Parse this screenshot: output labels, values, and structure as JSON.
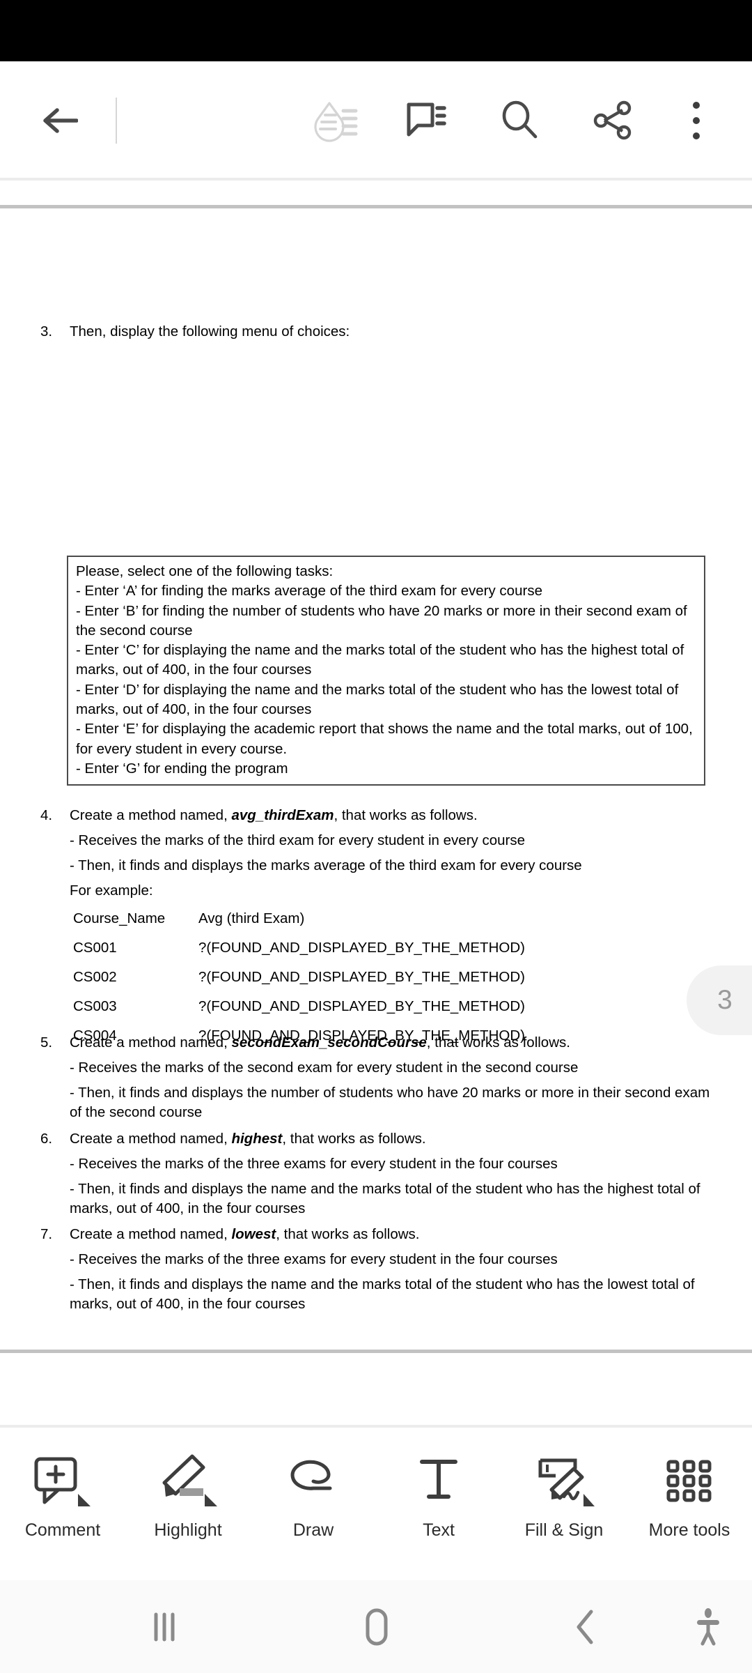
{
  "app": {
    "name": "pdf-reader",
    "accent": "#4a4a4a",
    "page_badge": "3"
  },
  "topbar": {
    "back_label": "Back",
    "icons": [
      {
        "name": "liquid-mode-icon",
        "label": "Liquid Mode",
        "state": "disabled",
        "color": "#d5d5d5"
      },
      {
        "name": "comment-icon",
        "label": "Comment",
        "state": "enabled",
        "color": "#4a4a4a"
      },
      {
        "name": "search-icon",
        "label": "Search",
        "state": "enabled",
        "color": "#4a4a4a"
      },
      {
        "name": "share-icon",
        "label": "Share",
        "state": "enabled",
        "color": "#4a4a4a"
      },
      {
        "name": "more-options-icon",
        "label": "More options",
        "state": "enabled",
        "color": "#4a4a4a"
      }
    ]
  },
  "document": {
    "items": [
      {
        "number": "3.",
        "text": "Then, display the following menu of choices:"
      },
      {
        "number": "4.",
        "text_before": "Create a method named, ",
        "method_name": "avg_thirdExam",
        "text_after": ", that works as follows.",
        "bullets": [
          "- Receives the marks of the third exam for every student in every course",
          "- Then, it finds and displays the marks average of the third exam for every course",
          "For example:"
        ]
      },
      {
        "number": "5.",
        "text_before": "Create a method named, ",
        "method_name": "secondExam_secondCourse",
        "text_after": ", that works as follows.",
        "bullets": [
          "- Receives the marks of the second exam for every student in the second course",
          "- Then, it finds and displays the number of students who have 20 marks or more in their second exam of the second course"
        ]
      },
      {
        "number": "6.",
        "text_before": "Create a method named, ",
        "method_name": "highest",
        "text_after": ", that works as follows.",
        "bullets": [
          "- Receives the marks of the three exams for every student in the four courses",
          "- Then, it finds and displays the name and the marks total of the student who has the highest total of marks, out of 400, in the four courses"
        ]
      },
      {
        "number": "7.",
        "text_before": "Create a method named, ",
        "method_name": "lowest",
        "text_after": ", that works as follows.",
        "bullets": [
          "- Receives the marks of the three exams for every student in the four courses",
          "- Then, it finds and displays the name and the marks total of the student who has the lowest total of marks, out of 400, in the four courses"
        ]
      }
    ],
    "menu_box": {
      "lines": [
        "Please, select one of the following tasks:",
        "- Enter ‘A’ for finding the marks average of the third exam for every course",
        "- Enter ‘B’ for finding the number of students who have 20 marks or more in their second exam of the second course",
        "- Enter ‘C’ for displaying the name and the marks total of the student who has the highest total of marks, out of 400, in the four courses",
        "- Enter ‘D’ for displaying the name and the marks total of the student who has the lowest total of marks, out of 400, in the four courses",
        "- Enter ‘E’ for displaying the academic report that shows the name and the total marks, out of 100, for every student in every course.",
        "- Enter ‘G’ for ending the program"
      ]
    },
    "example_table": {
      "headers": [
        "Course_Name",
        "Avg (third Exam)"
      ],
      "rows": [
        [
          "CS001",
          "?(FOUND_AND_DISPLAYED_BY_THE_METHOD)"
        ],
        [
          "CS002",
          "?(FOUND_AND_DISPLAYED_BY_THE_METHOD)"
        ],
        [
          "CS003",
          "?(FOUND_AND_DISPLAYED_BY_THE_METHOD)"
        ],
        [
          "CS004",
          "?(FOUND_AND_DISPLAYED_BY_THE_METHOD)"
        ]
      ]
    }
  },
  "toolbar": {
    "tools": [
      {
        "icon": "comment-add-icon",
        "label": "Comment",
        "has_dropdown": true
      },
      {
        "icon": "highlight-pen-icon",
        "label": "Highlight",
        "has_dropdown": true
      },
      {
        "icon": "draw-scribble-icon",
        "label": "Draw",
        "has_dropdown": false
      },
      {
        "icon": "text-tool-icon",
        "label": "Text",
        "has_dropdown": false
      },
      {
        "icon": "fill-and-sign-icon",
        "label": "Fill & Sign",
        "has_dropdown": true
      },
      {
        "icon": "grid-more-icon",
        "label": "More tools",
        "has_dropdown": false
      }
    ]
  },
  "navbar": {
    "buttons": [
      {
        "icon": "recents-icon",
        "label": "Recents"
      },
      {
        "icon": "home-icon",
        "label": "Home"
      },
      {
        "icon": "back-icon",
        "label": "Back"
      },
      {
        "icon": "accessibility-icon",
        "label": "Accessibility"
      }
    ]
  }
}
